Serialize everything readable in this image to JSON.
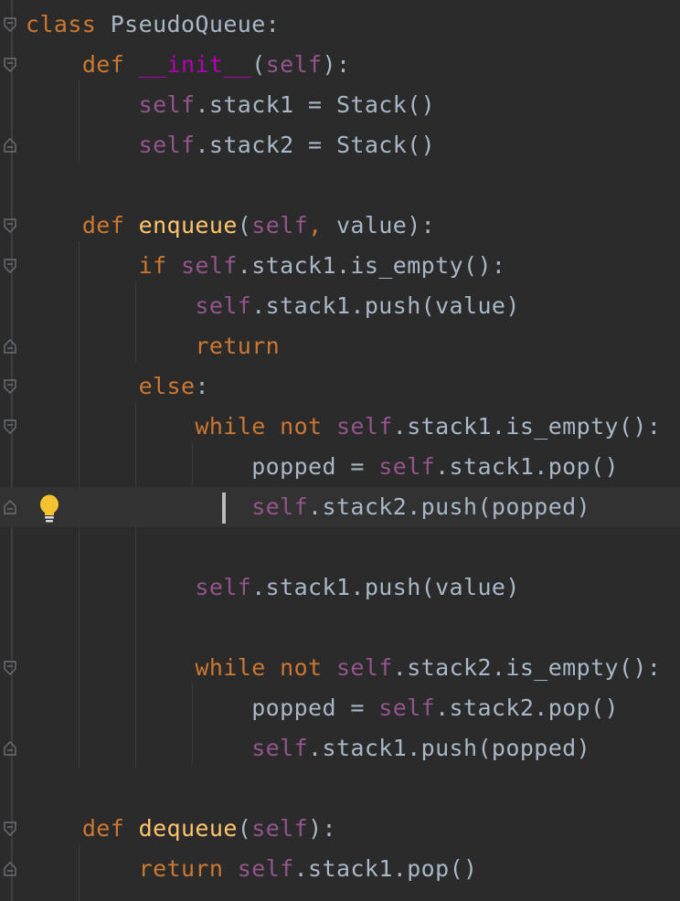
{
  "editor": {
    "lines": [
      {
        "tokens": [
          {
            "t": "class",
            "c": "kw"
          },
          {
            "t": " PseudoQueue:",
            "c": "pl"
          }
        ],
        "fold": "open"
      },
      {
        "tokens": [
          {
            "t": "    ",
            "c": "pl"
          },
          {
            "t": "def",
            "c": "kw"
          },
          {
            "t": " ",
            "c": "pl"
          },
          {
            "t": "__init__",
            "c": "dunder"
          },
          {
            "t": "(",
            "c": "pl"
          },
          {
            "t": "self",
            "c": "slf"
          },
          {
            "t": "):",
            "c": "pl"
          }
        ],
        "fold": "open"
      },
      {
        "tokens": [
          {
            "t": "        ",
            "c": "pl"
          },
          {
            "t": "self",
            "c": "slf"
          },
          {
            "t": ".stack1 = Stack()",
            "c": "pl"
          }
        ],
        "fold": ""
      },
      {
        "tokens": [
          {
            "t": "        ",
            "c": "pl"
          },
          {
            "t": "self",
            "c": "slf"
          },
          {
            "t": ".stack2 = Stack()",
            "c": "pl"
          }
        ],
        "fold": "end"
      },
      {
        "tokens": [],
        "fold": ""
      },
      {
        "tokens": [
          {
            "t": "    ",
            "c": "pl"
          },
          {
            "t": "def",
            "c": "kw"
          },
          {
            "t": " ",
            "c": "pl"
          },
          {
            "t": "enqueue",
            "c": "fn"
          },
          {
            "t": "(",
            "c": "pl"
          },
          {
            "t": "self",
            "c": "slf"
          },
          {
            "t": ",",
            "c": "kw"
          },
          {
            "t": " value):",
            "c": "pl"
          }
        ],
        "fold": "open"
      },
      {
        "tokens": [
          {
            "t": "        ",
            "c": "pl"
          },
          {
            "t": "if",
            "c": "kw"
          },
          {
            "t": " ",
            "c": "pl"
          },
          {
            "t": "self",
            "c": "slf"
          },
          {
            "t": ".stack1.is_empty():",
            "c": "pl"
          }
        ],
        "fold": "open"
      },
      {
        "tokens": [
          {
            "t": "            ",
            "c": "pl"
          },
          {
            "t": "self",
            "c": "slf"
          },
          {
            "t": ".stack1.push(value)",
            "c": "pl"
          }
        ],
        "fold": ""
      },
      {
        "tokens": [
          {
            "t": "            ",
            "c": "pl"
          },
          {
            "t": "return",
            "c": "kw"
          }
        ],
        "fold": "end"
      },
      {
        "tokens": [
          {
            "t": "        ",
            "c": "pl"
          },
          {
            "t": "else",
            "c": "kw"
          },
          {
            "t": ":",
            "c": "pl"
          }
        ],
        "fold": "open"
      },
      {
        "tokens": [
          {
            "t": "            ",
            "c": "pl"
          },
          {
            "t": "while",
            "c": "kw"
          },
          {
            "t": " ",
            "c": "pl"
          },
          {
            "t": "not",
            "c": "kw"
          },
          {
            "t": " ",
            "c": "pl"
          },
          {
            "t": "self",
            "c": "slf"
          },
          {
            "t": ".stack1.is_empty():",
            "c": "pl"
          }
        ],
        "fold": "open"
      },
      {
        "tokens": [
          {
            "t": "                ",
            "c": "pl"
          },
          {
            "t": "popped = ",
            "c": "pl"
          },
          {
            "t": "self",
            "c": "slf"
          },
          {
            "t": ".stack1.pop()",
            "c": "pl"
          }
        ],
        "fold": ""
      },
      {
        "tokens": [
          {
            "t": "                ",
            "c": "pl"
          },
          {
            "t": "self",
            "c": "slf"
          },
          {
            "t": ".stack2.push(popped)",
            "c": "pl"
          }
        ],
        "fold": "end",
        "current": true
      },
      {
        "tokens": [],
        "fold": ""
      },
      {
        "tokens": [
          {
            "t": "            ",
            "c": "pl"
          },
          {
            "t": "self",
            "c": "slf"
          },
          {
            "t": ".stack1.push(value)",
            "c": "pl"
          }
        ],
        "fold": ""
      },
      {
        "tokens": [],
        "fold": ""
      },
      {
        "tokens": [
          {
            "t": "            ",
            "c": "pl"
          },
          {
            "t": "while",
            "c": "kw"
          },
          {
            "t": " ",
            "c": "pl"
          },
          {
            "t": "not",
            "c": "kw"
          },
          {
            "t": " ",
            "c": "pl"
          },
          {
            "t": "self",
            "c": "slf"
          },
          {
            "t": ".stack2.is_empty():",
            "c": "pl"
          }
        ],
        "fold": "open"
      },
      {
        "tokens": [
          {
            "t": "                ",
            "c": "pl"
          },
          {
            "t": "popped = ",
            "c": "pl"
          },
          {
            "t": "self",
            "c": "slf"
          },
          {
            "t": ".stack2.pop()",
            "c": "pl"
          }
        ],
        "fold": ""
      },
      {
        "tokens": [
          {
            "t": "                ",
            "c": "pl"
          },
          {
            "t": "self",
            "c": "slf"
          },
          {
            "t": ".stack1.push(popped)",
            "c": "pl"
          }
        ],
        "fold": "end"
      },
      {
        "tokens": [],
        "fold": ""
      },
      {
        "tokens": [
          {
            "t": "    ",
            "c": "pl"
          },
          {
            "t": "def",
            "c": "kw"
          },
          {
            "t": " ",
            "c": "pl"
          },
          {
            "t": "dequeue",
            "c": "fn"
          },
          {
            "t": "(",
            "c": "pl"
          },
          {
            "t": "self",
            "c": "slf"
          },
          {
            "t": "):",
            "c": "pl"
          }
        ],
        "fold": "open"
      },
      {
        "tokens": [
          {
            "t": "        ",
            "c": "pl"
          },
          {
            "t": "return",
            "c": "kw"
          },
          {
            "t": " ",
            "c": "pl"
          },
          {
            "t": "self",
            "c": "slf"
          },
          {
            "t": ".stack1.pop()",
            "c": "pl"
          }
        ],
        "fold": "end"
      }
    ],
    "intention_icon": "lightbulb-icon",
    "colors": {
      "background": "#2b2b2b",
      "keyword": "#cc7832",
      "self": "#94558d",
      "function": "#ffc66d",
      "dunder": "#b200b2",
      "plain": "#a9b7c6",
      "current_line": "#323232"
    }
  }
}
